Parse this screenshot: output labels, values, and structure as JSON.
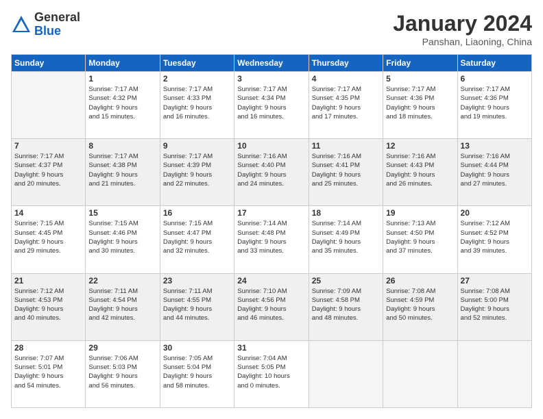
{
  "logo": {
    "general": "General",
    "blue": "Blue"
  },
  "title": "January 2024",
  "subtitle": "Panshan, Liaoning, China",
  "weekdays": [
    "Sunday",
    "Monday",
    "Tuesday",
    "Wednesday",
    "Thursday",
    "Friday",
    "Saturday"
  ],
  "weeks": [
    [
      {
        "day": "",
        "info": ""
      },
      {
        "day": "1",
        "info": "Sunrise: 7:17 AM\nSunset: 4:32 PM\nDaylight: 9 hours\nand 15 minutes."
      },
      {
        "day": "2",
        "info": "Sunrise: 7:17 AM\nSunset: 4:33 PM\nDaylight: 9 hours\nand 16 minutes."
      },
      {
        "day": "3",
        "info": "Sunrise: 7:17 AM\nSunset: 4:34 PM\nDaylight: 9 hours\nand 16 minutes."
      },
      {
        "day": "4",
        "info": "Sunrise: 7:17 AM\nSunset: 4:35 PM\nDaylight: 9 hours\nand 17 minutes."
      },
      {
        "day": "5",
        "info": "Sunrise: 7:17 AM\nSunset: 4:36 PM\nDaylight: 9 hours\nand 18 minutes."
      },
      {
        "day": "6",
        "info": "Sunrise: 7:17 AM\nSunset: 4:36 PM\nDaylight: 9 hours\nand 19 minutes."
      }
    ],
    [
      {
        "day": "7",
        "info": "Sunrise: 7:17 AM\nSunset: 4:37 PM\nDaylight: 9 hours\nand 20 minutes."
      },
      {
        "day": "8",
        "info": "Sunrise: 7:17 AM\nSunset: 4:38 PM\nDaylight: 9 hours\nand 21 minutes."
      },
      {
        "day": "9",
        "info": "Sunrise: 7:17 AM\nSunset: 4:39 PM\nDaylight: 9 hours\nand 22 minutes."
      },
      {
        "day": "10",
        "info": "Sunrise: 7:16 AM\nSunset: 4:40 PM\nDaylight: 9 hours\nand 24 minutes."
      },
      {
        "day": "11",
        "info": "Sunrise: 7:16 AM\nSunset: 4:41 PM\nDaylight: 9 hours\nand 25 minutes."
      },
      {
        "day": "12",
        "info": "Sunrise: 7:16 AM\nSunset: 4:43 PM\nDaylight: 9 hours\nand 26 minutes."
      },
      {
        "day": "13",
        "info": "Sunrise: 7:16 AM\nSunset: 4:44 PM\nDaylight: 9 hours\nand 27 minutes."
      }
    ],
    [
      {
        "day": "14",
        "info": "Sunrise: 7:15 AM\nSunset: 4:45 PM\nDaylight: 9 hours\nand 29 minutes."
      },
      {
        "day": "15",
        "info": "Sunrise: 7:15 AM\nSunset: 4:46 PM\nDaylight: 9 hours\nand 30 minutes."
      },
      {
        "day": "16",
        "info": "Sunrise: 7:15 AM\nSunset: 4:47 PM\nDaylight: 9 hours\nand 32 minutes."
      },
      {
        "day": "17",
        "info": "Sunrise: 7:14 AM\nSunset: 4:48 PM\nDaylight: 9 hours\nand 33 minutes."
      },
      {
        "day": "18",
        "info": "Sunrise: 7:14 AM\nSunset: 4:49 PM\nDaylight: 9 hours\nand 35 minutes."
      },
      {
        "day": "19",
        "info": "Sunrise: 7:13 AM\nSunset: 4:50 PM\nDaylight: 9 hours\nand 37 minutes."
      },
      {
        "day": "20",
        "info": "Sunrise: 7:12 AM\nSunset: 4:52 PM\nDaylight: 9 hours\nand 39 minutes."
      }
    ],
    [
      {
        "day": "21",
        "info": "Sunrise: 7:12 AM\nSunset: 4:53 PM\nDaylight: 9 hours\nand 40 minutes."
      },
      {
        "day": "22",
        "info": "Sunrise: 7:11 AM\nSunset: 4:54 PM\nDaylight: 9 hours\nand 42 minutes."
      },
      {
        "day": "23",
        "info": "Sunrise: 7:11 AM\nSunset: 4:55 PM\nDaylight: 9 hours\nand 44 minutes."
      },
      {
        "day": "24",
        "info": "Sunrise: 7:10 AM\nSunset: 4:56 PM\nDaylight: 9 hours\nand 46 minutes."
      },
      {
        "day": "25",
        "info": "Sunrise: 7:09 AM\nSunset: 4:58 PM\nDaylight: 9 hours\nand 48 minutes."
      },
      {
        "day": "26",
        "info": "Sunrise: 7:08 AM\nSunset: 4:59 PM\nDaylight: 9 hours\nand 50 minutes."
      },
      {
        "day": "27",
        "info": "Sunrise: 7:08 AM\nSunset: 5:00 PM\nDaylight: 9 hours\nand 52 minutes."
      }
    ],
    [
      {
        "day": "28",
        "info": "Sunrise: 7:07 AM\nSunset: 5:01 PM\nDaylight: 9 hours\nand 54 minutes."
      },
      {
        "day": "29",
        "info": "Sunrise: 7:06 AM\nSunset: 5:03 PM\nDaylight: 9 hours\nand 56 minutes."
      },
      {
        "day": "30",
        "info": "Sunrise: 7:05 AM\nSunset: 5:04 PM\nDaylight: 9 hours\nand 58 minutes."
      },
      {
        "day": "31",
        "info": "Sunrise: 7:04 AM\nSunset: 5:05 PM\nDaylight: 10 hours\nand 0 minutes."
      },
      {
        "day": "",
        "info": ""
      },
      {
        "day": "",
        "info": ""
      },
      {
        "day": "",
        "info": ""
      }
    ]
  ]
}
